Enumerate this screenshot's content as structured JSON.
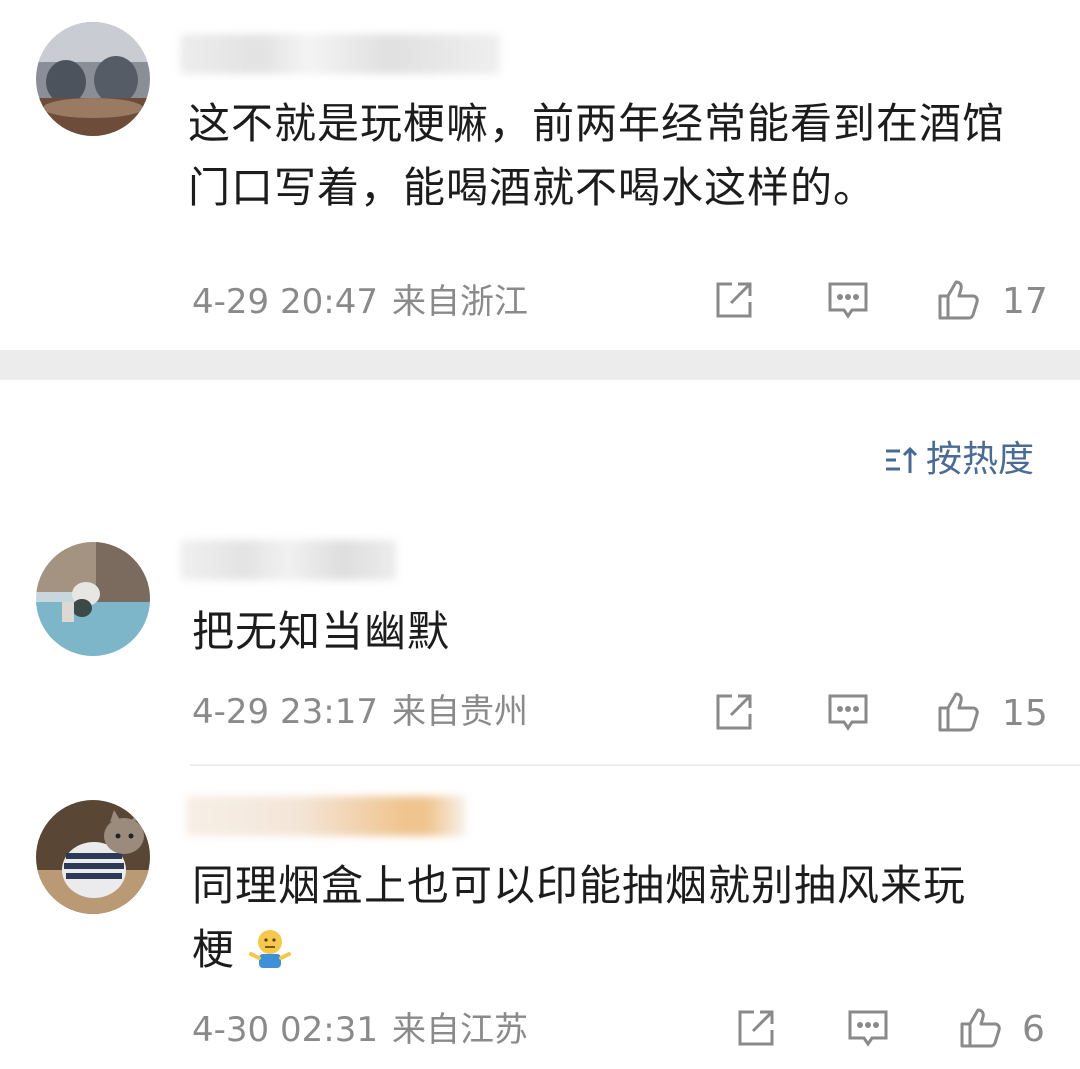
{
  "comments": [
    {
      "text_lines": [
        "这不就是玩梗嘛，前两年经常能看到在酒馆",
        "门口写着，能喝酒就不喝水这样的。"
      ],
      "time": "4-29 20:47",
      "location": "来自浙江",
      "likes": "17"
    },
    {
      "text_lines": [
        "把无知当幽默"
      ],
      "time": "4-29 23:17",
      "location": "来自贵州",
      "likes": "15"
    },
    {
      "text_lines": [
        "同理烟盒上也可以印能抽烟就别抽风来玩",
        "梗"
      ],
      "time": "4-30 02:31",
      "location": "来自江苏",
      "likes": "6"
    }
  ],
  "sort_label": "按热度",
  "icons": {
    "share": "share-icon",
    "comment": "comment-icon",
    "like": "thumbs-up-icon",
    "sort": "sort-icon",
    "emoji": "shrug-emoji-icon"
  },
  "colors": {
    "text": "#1c1c1c",
    "meta": "#8a8a8a",
    "accent": "#4a6b93",
    "separator": "#ececec"
  }
}
